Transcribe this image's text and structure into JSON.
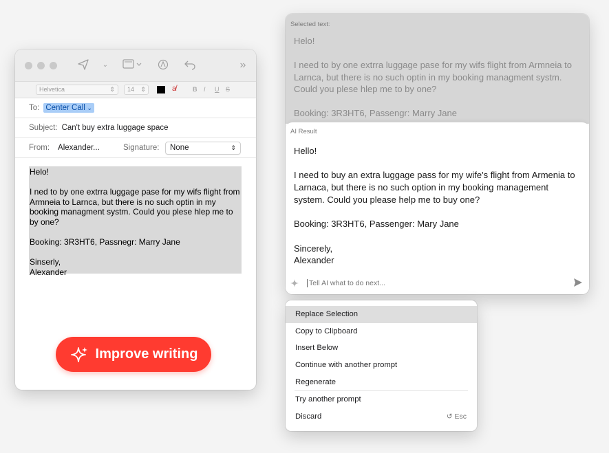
{
  "mail": {
    "format": {
      "font": "Helvetica",
      "size": "14",
      "bold": "B",
      "italic": "I",
      "underline": "U",
      "strike": "S"
    },
    "to_label": "To:",
    "to_value": "Center Call",
    "subject_label": "Subject:",
    "subject_value": "Can't buy extra luggage space",
    "from_label": "From:",
    "from_value": "Alexander...",
    "signature_label": "Signature:",
    "signature_value": "None",
    "body": "Helo!\n\nI ned to by one extrra luggage pase for my wifs flight from Armneia to Larnca, but there is no such optin in my booking managment systm. Could you plese hlep me to by one?\n\nBooking: 3R3HT6, Passnegr: Marry Jane\n\nSinserly,\nAlexander"
  },
  "improve_button": {
    "label": "Improve writing",
    "color": "#ff3b30"
  },
  "ai_panel": {
    "selected_label": "Selected text:",
    "selected_text": "Helo!\n\nI need to by one extrra luggage pase for my wifs flight from Armneia to Larnca, but there is no such optin in my booking managment systm. Could you plese hlep me to by one?\n\nBooking: 3R3HT6, Passengr: Marry Jane",
    "result_label": "AI Result",
    "result_text": "Hello!\n\nI need to buy an extra luggage pass for my wife's flight from Armenia to Larnaca, but there is no such option in my booking management system. Could you please help me to buy one?\n\nBooking: 3R3HT6, Passenger: Mary Jane\n\nSincerely,\nAlexander",
    "prompt_placeholder": "Tell AI what to do next..."
  },
  "menu": {
    "items": [
      {
        "label": "Replace Selection"
      },
      {
        "label": "Copy to Clipboard"
      },
      {
        "label": "Insert Below"
      },
      {
        "label": "Continue with another prompt"
      },
      {
        "label": "Regenerate"
      },
      {
        "label": "Try another prompt"
      },
      {
        "label": "Discard",
        "shortcut": "Esc"
      }
    ]
  }
}
